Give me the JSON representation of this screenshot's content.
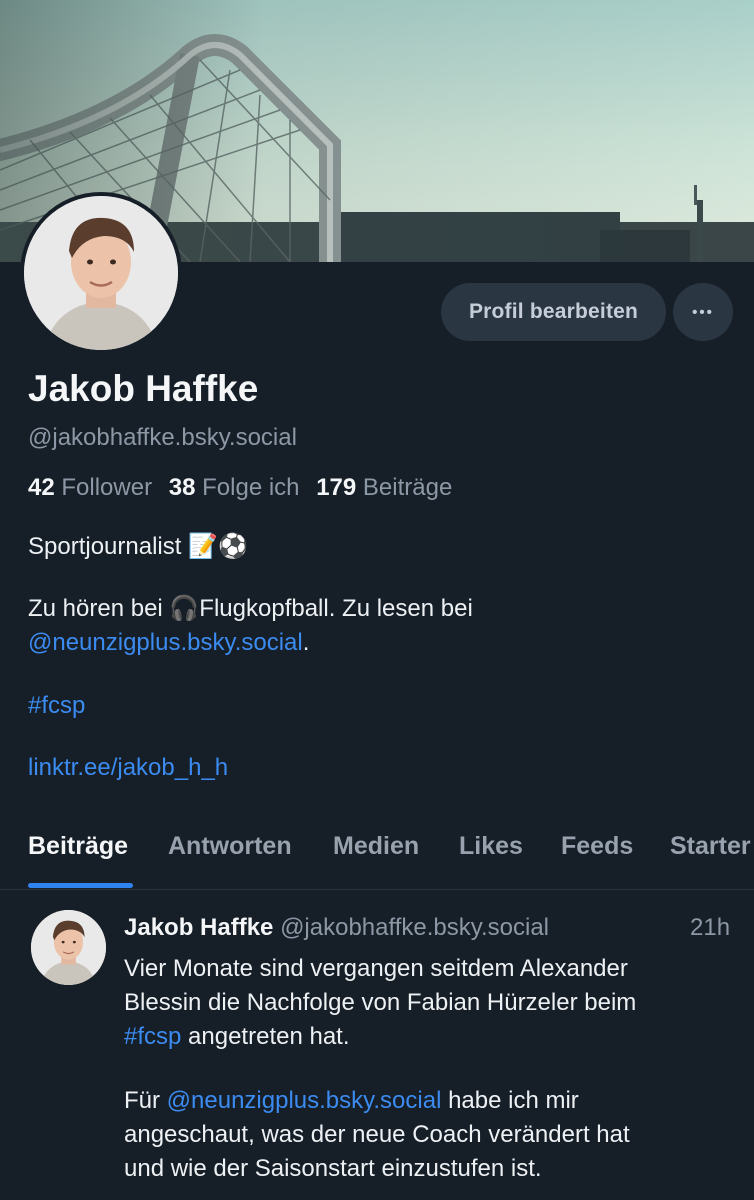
{
  "profile": {
    "display_name": "Jakob Haffke",
    "handle": "@jakobhaffke.bsky.social",
    "followers_count": "42",
    "followers_label": "Follower",
    "following_count": "38",
    "following_label": "Folge ich",
    "posts_count": "179",
    "posts_label": "Beiträge",
    "bio_line1": "Sportjournalist 📝⚽",
    "bio_line2_prefix": "Zu hören bei 🎧Flugkopfball. Zu lesen bei",
    "bio_mention": "@neunzigplus.bsky.social",
    "bio_mention_suffix": ".",
    "bio_hashtag": "#fcsp",
    "bio_link": "linktr.ee/jakob_h_h"
  },
  "actions": {
    "edit_label": "Profil bearbeiten",
    "more_label": "•••"
  },
  "tabs": [
    {
      "label": "Beiträge",
      "active": true
    },
    {
      "label": "Antworten"
    },
    {
      "label": "Medien"
    },
    {
      "label": "Likes"
    },
    {
      "label": "Feeds"
    },
    {
      "label": "Starter"
    }
  ],
  "post": {
    "author_name": "Jakob Haffke",
    "author_handle": "@jakobhaffke.bsky.social",
    "time": "21h",
    "p1_line1": "Vier Monate sind vergangen seitdem Alexander",
    "p1_line2": "Blessin die Nachfolge von Fabian Hürzeler beim",
    "p1_line3_hashtag": "#fcsp",
    "p1_line3_rest": " angetreten hat.",
    "p2_prefix": "Für ",
    "p2_mention": "@neunzigplus.bsky.social",
    "p2_line1_rest": " habe ich mir",
    "p2_line2": "angeschaut, was der neue Coach verändert hat",
    "p2_line3": "und wie der Saisonstart einzustufen ist."
  },
  "colors": {
    "background": "#161e27",
    "accent_link": "#3b8bf0",
    "tab_indicator": "#2f83ee",
    "button_bg": "#2b3643",
    "muted_text": "#8c98a6"
  },
  "icons": {
    "more": "ellipsis-icon"
  }
}
